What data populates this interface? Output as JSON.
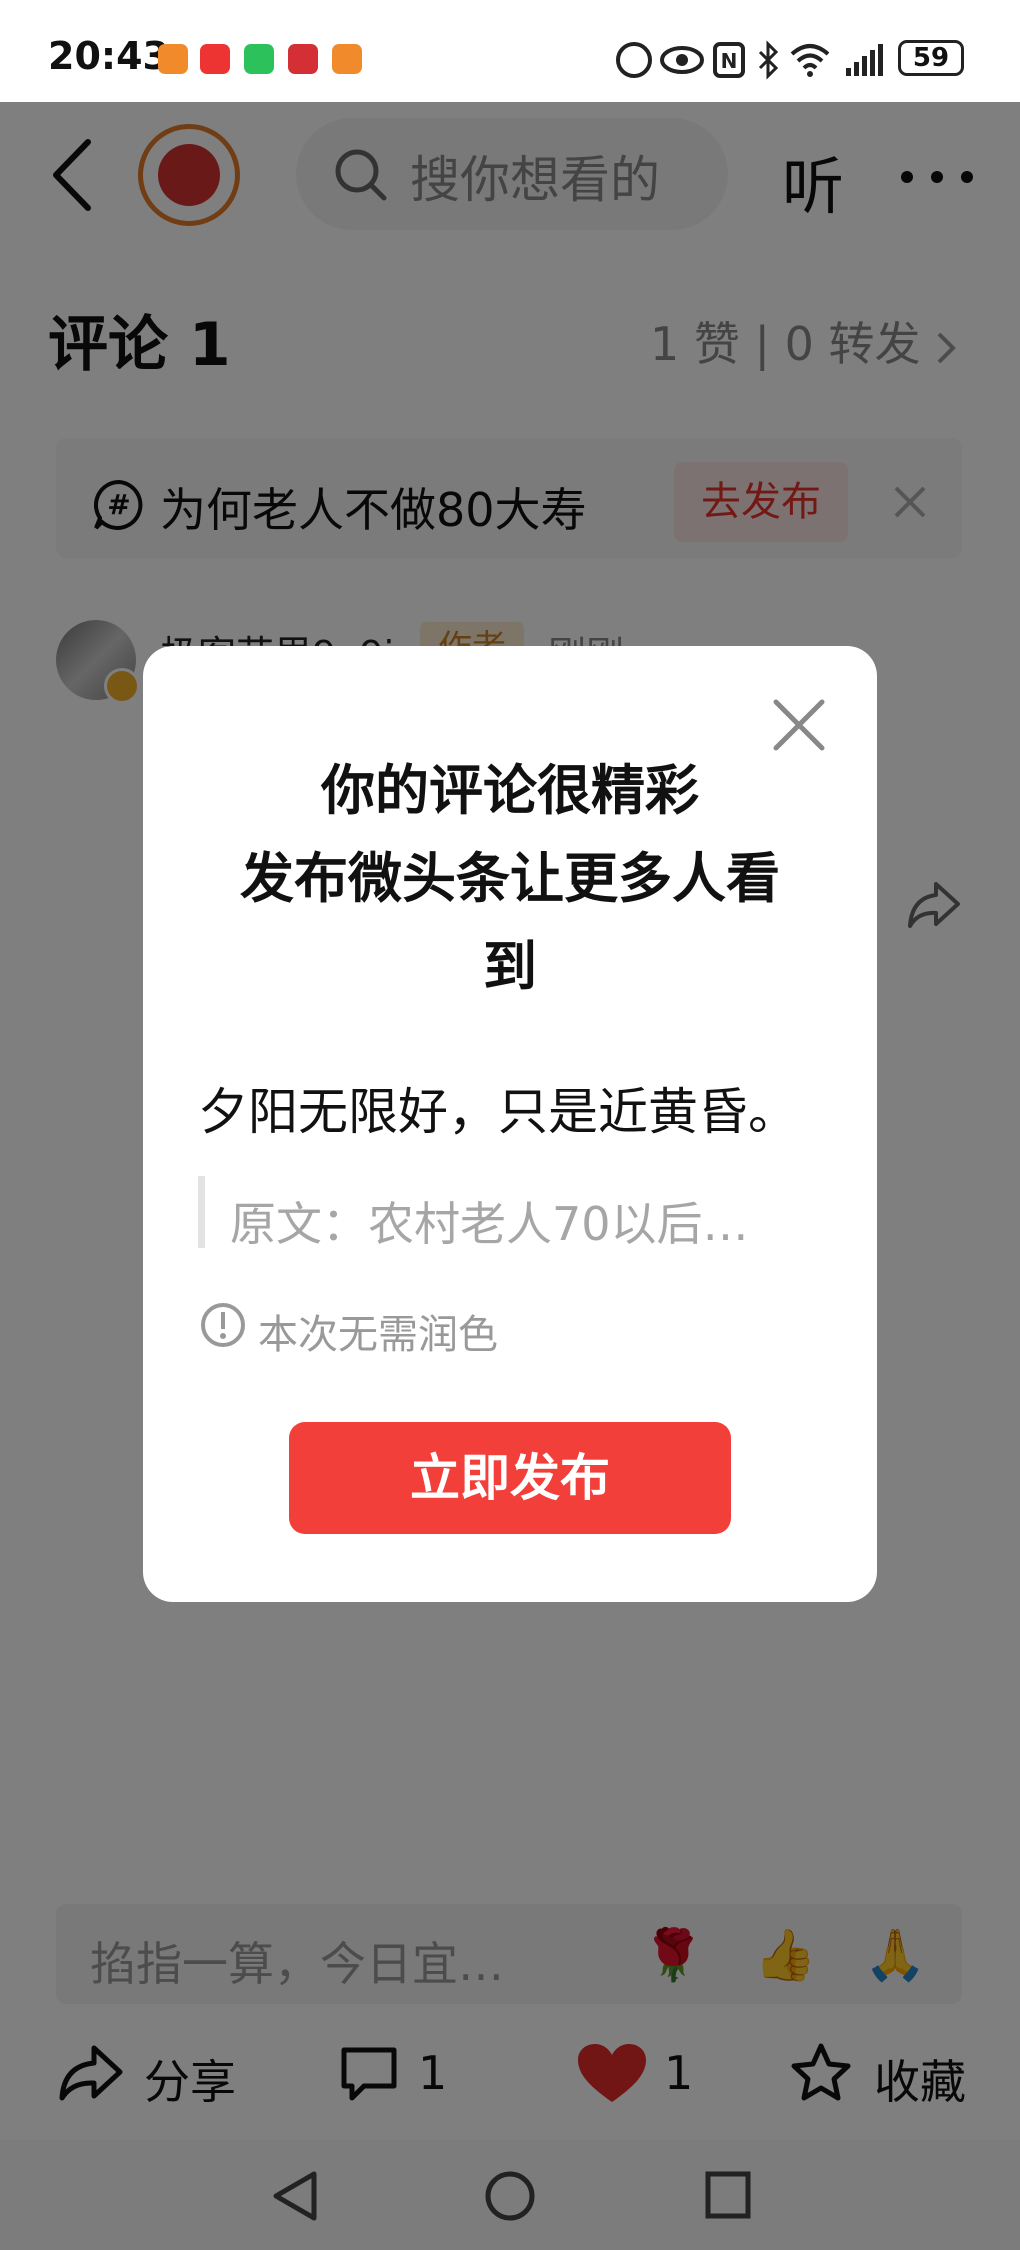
{
  "status_bar": {
    "time": "20:43",
    "battery": "59"
  },
  "nav": {
    "search_placeholder": "搜你想看的",
    "listen_label": "听"
  },
  "comments": {
    "title": "评论 1",
    "stats": "1 赞 | 0 转发"
  },
  "topic": {
    "text": "为何老人不做80大寿",
    "action_label": "去发布"
  },
  "comment": {
    "user_name": "极客花里9o9i",
    "author_tag": "作者",
    "time": "刚刚"
  },
  "dialog": {
    "title_line1": "你的评论很精彩",
    "title_line2": "发布微头条让更多人看",
    "title_line3": "到",
    "body": "夕阳无限好，只是近黄昏。",
    "quote": "原文：农村老人70以后…",
    "hint": "本次无需润色",
    "publish_label": "立即发布"
  },
  "input": {
    "placeholder": "掐指一算，今日宜…",
    "emojis": [
      "🌹",
      "👍",
      "🙏"
    ]
  },
  "actions": {
    "share_label": "分享",
    "comment_count": "1",
    "like_count": "1",
    "favorite_label": "收藏"
  },
  "colors": {
    "accent_red": "#f23f3a",
    "like_red": "#e52b2b",
    "overlay": "rgba(0,0,0,0.5)"
  }
}
